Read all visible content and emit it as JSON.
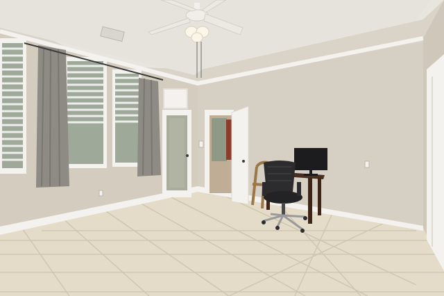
{
  "scene": {
    "type": "interior-photo",
    "subject": "empty-room-with-desk",
    "elements": [
      "ceiling-fan-icon",
      "window-blinds",
      "curtains",
      "glass-door",
      "open-interior-door",
      "office-chair",
      "wooden-chair",
      "desk",
      "monitor",
      "tile-floor",
      "baseboard"
    ]
  },
  "palette": {
    "wall": "#d6cfc3",
    "wall_shadow": "#c4bcae",
    "ceiling": "#e6e3dd",
    "trim": "#f4f2ee",
    "floor": "#e4dcc8",
    "floor_grout": "#cfc6b0",
    "curtain": "#8e8a84",
    "blind": "#eeeeec",
    "window_view": "#9fa99a",
    "chair": "#2c2c2e",
    "desk": "#4a2e1f",
    "monitor": "#1c1c1e",
    "wood_chair": "#b08a58"
  }
}
